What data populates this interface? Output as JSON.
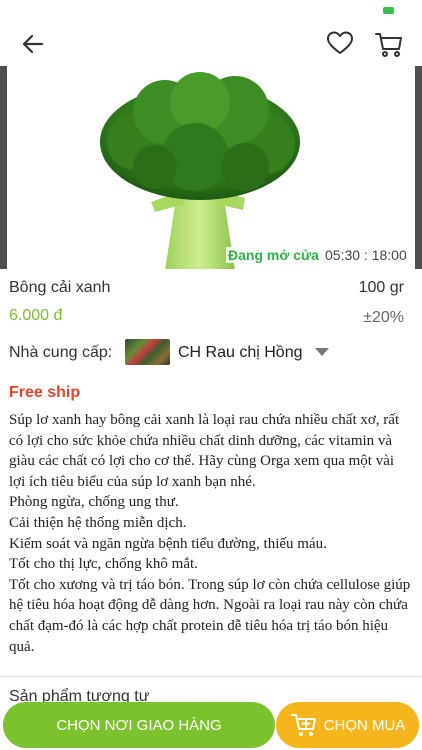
{
  "header": {
    "back_icon": "arrow-left-icon",
    "favorite_icon": "heart-icon",
    "cart_icon": "cart-icon"
  },
  "hero": {
    "open_status": "Đang mở cửa",
    "hours": "05:30 : 18:00"
  },
  "product": {
    "name": "Bông cải xanh",
    "weight": "100 gr",
    "price": "6.000 đ",
    "tolerance": "±20%"
  },
  "supplier": {
    "label": "Nhà cung cấp:",
    "name": "CH Rau chị Hồng"
  },
  "shipping": {
    "label": "Free ship"
  },
  "description": {
    "lines": [
      "Súp lơ xanh hay bông cải xanh là loại rau chứa nhiều chất xơ, rất có lợi cho sức khỏe chứa nhiều chất dinh dưỡng, các vitamin và giàu các chất có lợi cho cơ thể. Hãy cùng Orga xem qua một vài lợi ích tiêu biểu của súp lơ xanh bạn nhé.",
      "Phòng ngừa, chống ung thư.",
      "Cải thiện hệ thống miễn dịch.",
      "Kiểm soát và ngăn ngừa bệnh tiểu đường, thiếu máu.",
      "Tốt cho thị lực, chống khô mắt.",
      "Tốt cho xương và trị táo bón. Trong súp lơ còn chứa cellulose giúp hệ tiêu hóa hoạt động dễ dàng hơn. Ngoài ra loại rau này còn chứa chất đạm-đó là các hợp chất protein dễ tiêu hóa trị táo bón hiệu quả."
    ]
  },
  "related": {
    "title": "Sản phẩm tương tự"
  },
  "actions": {
    "choose_delivery": "CHỌN NƠI GIAO HÀNG",
    "buy": "CHỌN MUA"
  },
  "colors": {
    "green": "#7cc22e",
    "orange": "#f5b51c",
    "freeship_red": "#e2442c",
    "open_green": "#2fb24a"
  }
}
